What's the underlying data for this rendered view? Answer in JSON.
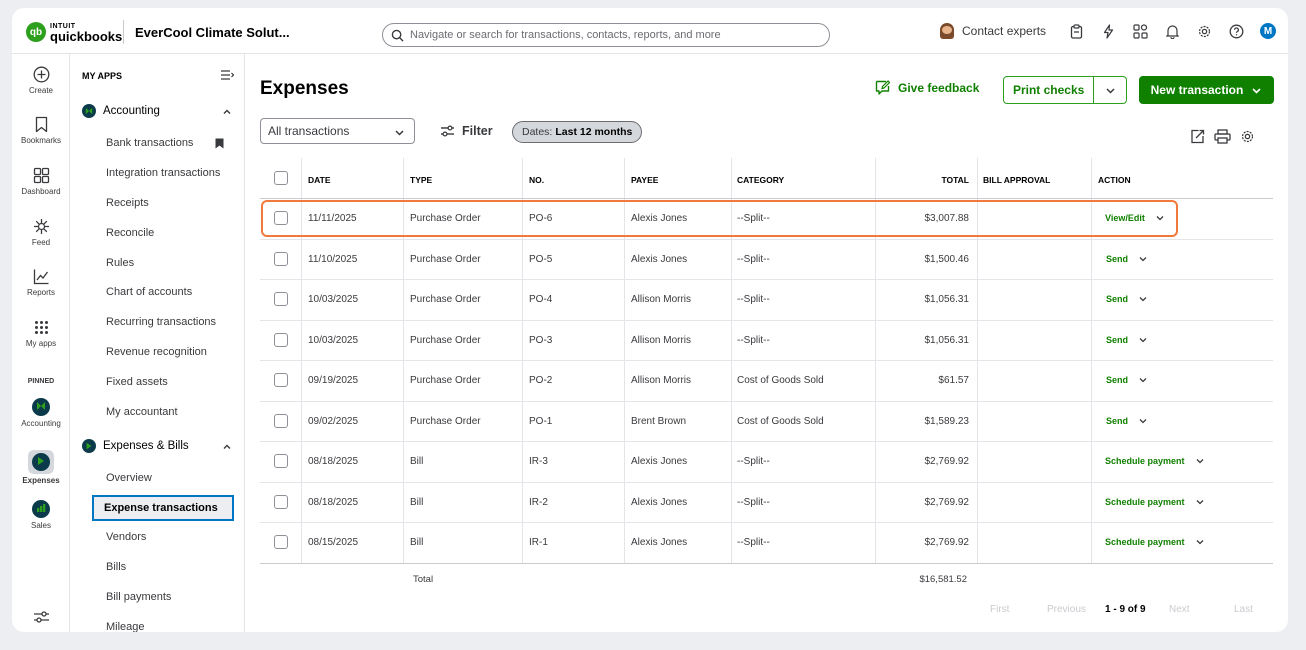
{
  "header": {
    "brand_intuit": "INTUIT",
    "brand_name": "quickbooks",
    "logo_mark": "qb",
    "company": "EverCool Climate Solut...",
    "search_placeholder": "Navigate or search for transactions, contacts, reports, and more",
    "contact_experts": "Contact experts",
    "user_initial": "M",
    "icons": [
      "clipboard-icon",
      "lightning-icon",
      "apps-icon",
      "bell-icon",
      "gear-icon",
      "help-icon"
    ]
  },
  "rail": {
    "create": "Create",
    "bookmarks": "Bookmarks",
    "dashboard": "Dashboard",
    "feed": "Feed",
    "reports": "Reports",
    "my_apps": "My apps",
    "pinned": "PINNED",
    "accounting": "Accounting",
    "expenses": "Expenses",
    "sales": "Sales"
  },
  "nav": {
    "my_apps": "MY APPS",
    "accounting_group": "Accounting",
    "accounting_items": [
      "Bank transactions",
      "Integration transactions",
      "Receipts",
      "Reconcile",
      "Rules",
      "Chart of accounts",
      "Recurring transactions",
      "Revenue recognition",
      "Fixed assets",
      "My accountant"
    ],
    "expenses_group": "Expenses & Bills",
    "expenses_items": [
      "Overview",
      "Expense transactions",
      "Vendors",
      "Bills",
      "Bill payments",
      "Mileage"
    ]
  },
  "main": {
    "title": "Expenses",
    "give_feedback": "Give feedback",
    "print_checks": "Print checks",
    "new_transaction": "New transaction",
    "filter_select": "All transactions",
    "filter": "Filter",
    "dates_label": "Dates:",
    "dates_value": "Last 12 months"
  },
  "table": {
    "headers": {
      "date": "DATE",
      "type": "TYPE",
      "no": "NO.",
      "payee": "PAYEE",
      "category": "CATEGORY",
      "total": "TOTAL",
      "bill_approval": "BILL APPROVAL",
      "action": "ACTION"
    },
    "rows": [
      {
        "date": "11/11/2025",
        "type": "Purchase Order",
        "no": "PO-6",
        "payee": "Alexis Jones",
        "category": "--Split--",
        "total": "$3,007.88",
        "action": "View/Edit"
      },
      {
        "date": "11/10/2025",
        "type": "Purchase Order",
        "no": "PO-5",
        "payee": "Alexis Jones",
        "category": "--Split--",
        "total": "$1,500.46",
        "action": "Send"
      },
      {
        "date": "10/03/2025",
        "type": "Purchase Order",
        "no": "PO-4",
        "payee": "Allison Morris",
        "category": "--Split--",
        "total": "$1,056.31",
        "action": "Send"
      },
      {
        "date": "10/03/2025",
        "type": "Purchase Order",
        "no": "PO-3",
        "payee": "Allison Morris",
        "category": "--Split--",
        "total": "$1,056.31",
        "action": "Send"
      },
      {
        "date": "09/19/2025",
        "type": "Purchase Order",
        "no": "PO-2",
        "payee": "Allison Morris",
        "category": "Cost of Goods Sold",
        "total": "$61.57",
        "action": "Send"
      },
      {
        "date": "09/02/2025",
        "type": "Purchase Order",
        "no": "PO-1",
        "payee": "Brent Brown",
        "category": "Cost of Goods Sold",
        "total": "$1,589.23",
        "action": "Send"
      },
      {
        "date": "08/18/2025",
        "type": "Bill",
        "no": "IR-3",
        "payee": "Alexis Jones",
        "category": "--Split--",
        "total": "$2,769.92",
        "action": "Schedule payment"
      },
      {
        "date": "08/18/2025",
        "type": "Bill",
        "no": "IR-2",
        "payee": "Alexis Jones",
        "category": "--Split--",
        "total": "$2,769.92",
        "action": "Schedule payment"
      },
      {
        "date": "08/15/2025",
        "type": "Bill",
        "no": "IR-1",
        "payee": "Alexis Jones",
        "category": "--Split--",
        "total": "$2,769.92",
        "action": "Schedule payment"
      }
    ],
    "total_label": "Total",
    "total_value": "$16,581.52"
  },
  "pager": {
    "first": "First",
    "previous": "Previous",
    "range": "1 - 9 of 9",
    "next": "Next",
    "last": "Last"
  },
  "colors": {
    "brand_green": "#2ca01c",
    "action_green": "#108000",
    "highlight_orange": "#ef7a3c",
    "active_blue": "#0077c5"
  }
}
